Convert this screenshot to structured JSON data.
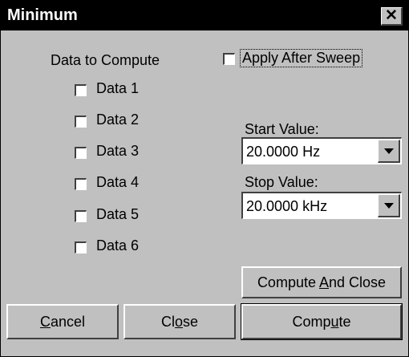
{
  "window": {
    "title": "Minimum",
    "close_label": "✕"
  },
  "data_section": {
    "header": "Data to Compute",
    "items": [
      {
        "label": "Data 1",
        "checked": false
      },
      {
        "label": "Data 2",
        "checked": false
      },
      {
        "label": "Data 3",
        "checked": false
      },
      {
        "label": "Data 4",
        "checked": false
      },
      {
        "label": "Data 5",
        "checked": false
      },
      {
        "label": "Data 6",
        "checked": false
      }
    ]
  },
  "apply_after_sweep": {
    "label": "Apply After Sweep",
    "checked": false
  },
  "start": {
    "label": "Start Value:",
    "value": "20.0000  Hz"
  },
  "stop": {
    "label": "Stop Value:",
    "value": "20.0000 kHz"
  },
  "buttons": {
    "compute_and_close": {
      "pre": "Compute ",
      "mn": "A",
      "post": "nd Close"
    },
    "cancel": {
      "pre": "",
      "mn": "C",
      "post": "ancel"
    },
    "close": {
      "pre": "Cl",
      "mn": "o",
      "post": "se"
    },
    "compute": {
      "pre": "Comp",
      "mn": "u",
      "post": "te"
    }
  }
}
